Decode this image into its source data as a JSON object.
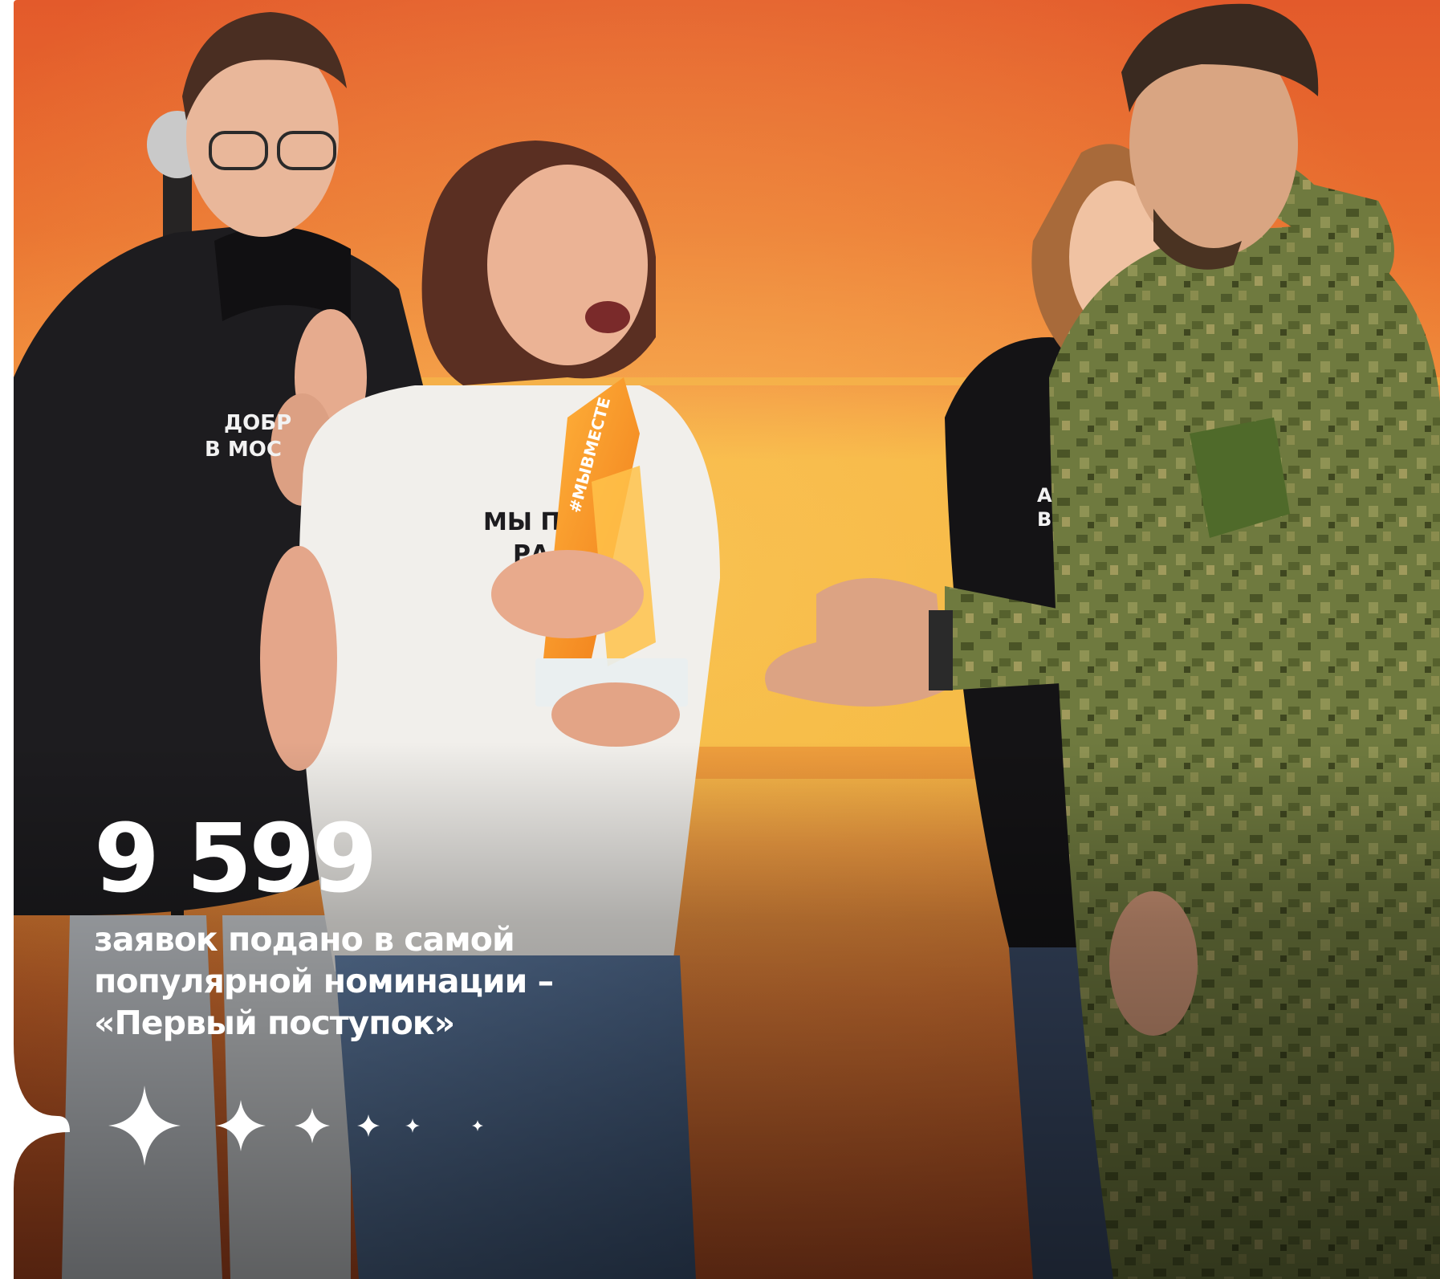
{
  "stat": {
    "number": "9 599",
    "caption_lines": [
      "заявок подано в самой",
      "популярной номинации –",
      "«Первый поступок»"
    ]
  },
  "photo": {
    "shirt_text_left": "ДОБР В МОС",
    "shirt_text_center": "МЫ ПО РА",
    "shirt_text_right": "АНИТ ВЕТО",
    "trophy_text": "#МЫВМЕСТЕ"
  },
  "colors": {
    "bg_orange": "#e8632a",
    "bg_yellow": "#f3b43a",
    "bg_deep": "#d8552a",
    "text": "#ffffff",
    "hoodie": "#1d1c1f",
    "tshirt": "#f1efeb",
    "camo": "#6e7a3e",
    "jeans": "#4e6b93"
  },
  "icons": [
    "sparkle-icon"
  ]
}
